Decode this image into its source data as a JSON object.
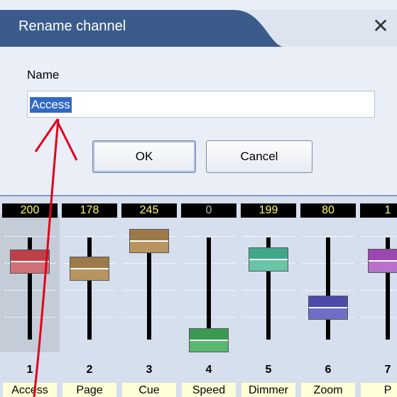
{
  "dialog": {
    "title": "Rename channel",
    "close_icon": "close-icon",
    "name_label": "Name",
    "name_value": "Access",
    "ok_label": "OK",
    "cancel_label": "Cancel"
  },
  "channels": [
    {
      "value": "200",
      "number": "1",
      "name": "Access"
    },
    {
      "value": "178",
      "number": "2",
      "name": "Page"
    },
    {
      "value": "245",
      "number": "3",
      "name": "Cue"
    },
    {
      "value": "0",
      "number": "4",
      "name": "Speed"
    },
    {
      "value": "199",
      "number": "5",
      "name": "Dimmer"
    },
    {
      "value": "80",
      "number": "6",
      "name": "Zoom"
    },
    {
      "value": "1",
      "number": "7",
      "name": "P"
    }
  ],
  "colors": {
    "titlebar": "#3a5b8c",
    "selection": "#3169c6",
    "value_text": "#ffff66",
    "annotation_arrow": "#e0001a"
  }
}
